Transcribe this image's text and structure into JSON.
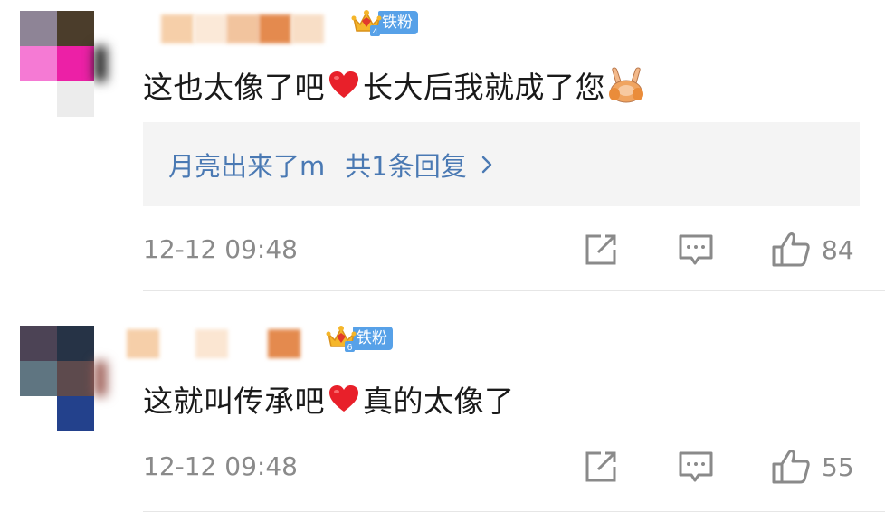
{
  "comments": [
    {
      "badge_level": "4",
      "badge_label": "铁粉",
      "text_a": "这也太像了吧",
      "text_b": "长大后我就成了您",
      "reply": {
        "user": "月亮出来了m",
        "summary": "共1条回复",
        "arrow": "›"
      },
      "time": "12-12 09:48",
      "likes": "84"
    },
    {
      "badge_level": "6",
      "badge_label": "铁粉",
      "text_a": "这就叫传承吧",
      "text_b": "真的太像了",
      "time": "12-12 09:48",
      "likes": "55"
    }
  ],
  "colors": {
    "badge_blue": "#57a1e8",
    "link_blue": "#4a79b3",
    "heart_red": "#e8202a",
    "meta_gray": "#8a8a8a"
  },
  "icons": [
    "heart-emoji",
    "victory-hand-emoji",
    "crown-icon",
    "share-icon",
    "comment-icon",
    "like-icon",
    "chevron-right-icon"
  ]
}
